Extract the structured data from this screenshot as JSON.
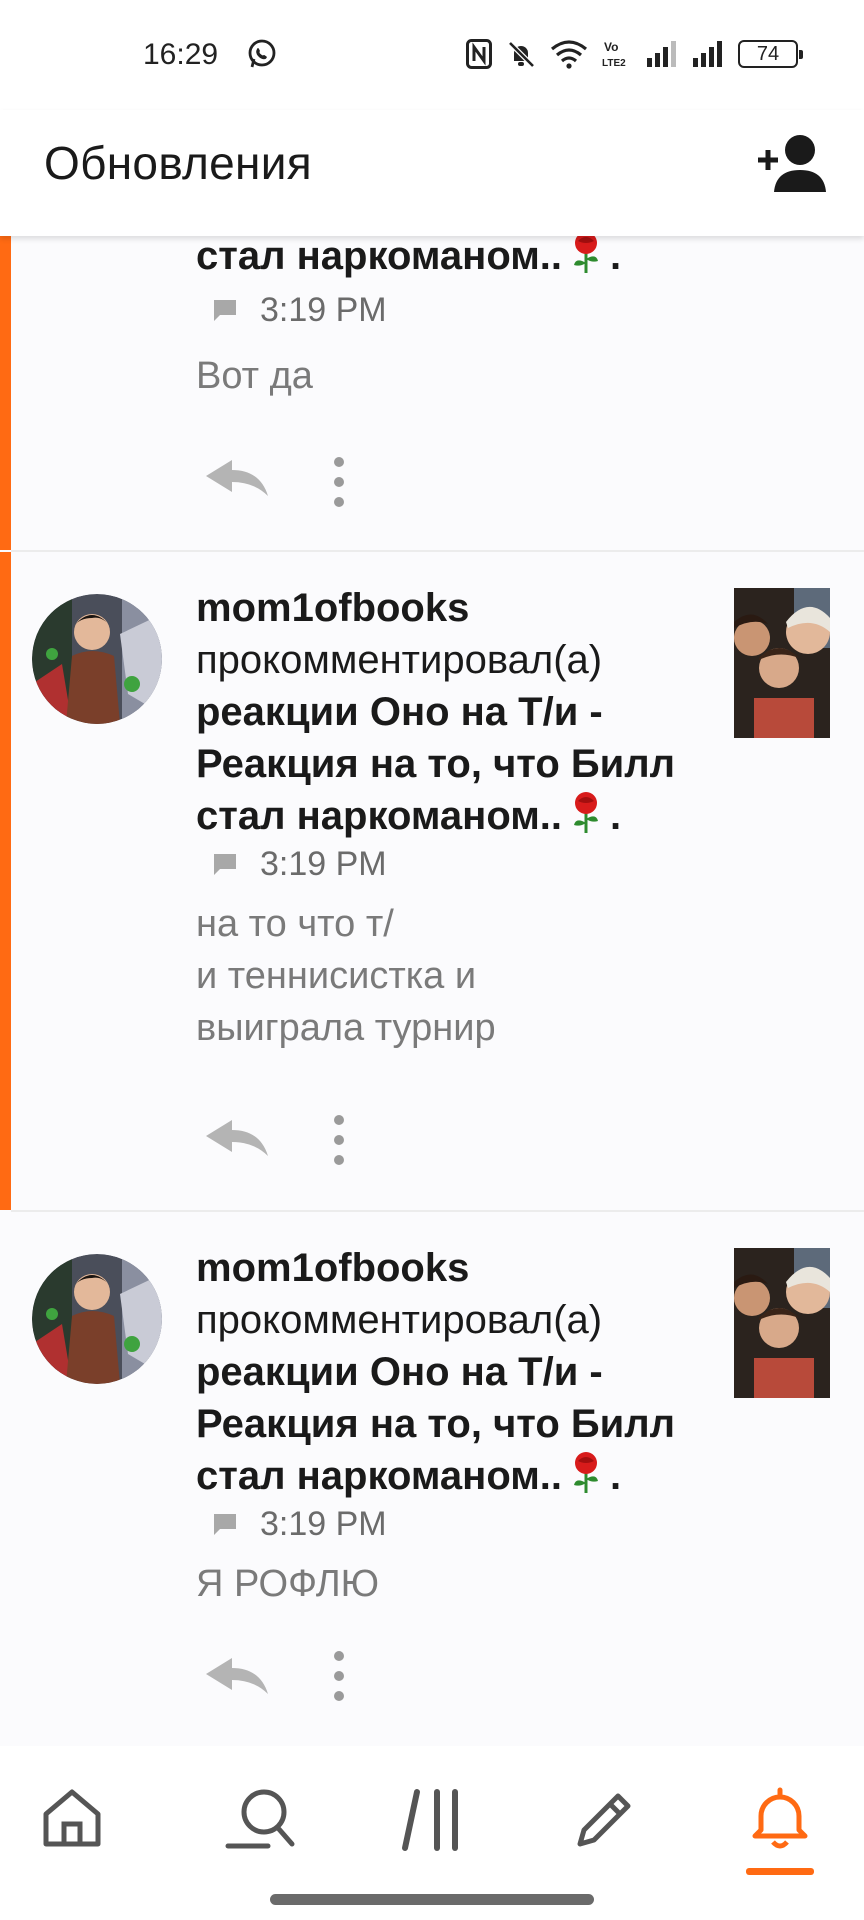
{
  "status_bar": {
    "time": "16:29",
    "battery": "74",
    "lte_top": "Vo",
    "lte_bottom": "LTE2"
  },
  "app_bar": {
    "title": "Обновления",
    "add_user_icon": "add-person-icon"
  },
  "feed": {
    "items": [
      {
        "title_tail": "стал наркоманом..",
        "dot": ".",
        "time": "3:19 PM",
        "comment": "Вот да",
        "unread": true
      },
      {
        "username": "mom1ofbooks",
        "action": "прокомментировал(а)",
        "title_lines": [
          "реакции Оно на Т/и -",
          "Реакция на то, что Билл",
          "стал наркоманом.."
        ],
        "dot": ".",
        "time": "3:19 PM",
        "comment_lines": [
          "на то что т/",
          "и теннисистка и",
          "выиграла турнир"
        ],
        "unread": true
      },
      {
        "username": "mom1ofbooks",
        "action": "прокомментировал(а)",
        "title_lines": [
          "реакции Оно на Т/и -",
          "Реакция на то, что Билл",
          "стал наркоманом.."
        ],
        "dot": ".",
        "time": "3:19 PM",
        "comment": "Я РОФЛЮ",
        "unread": false
      }
    ]
  },
  "bottom_nav": {
    "items": [
      "home-icon",
      "search-icon",
      "library-icon",
      "write-icon",
      "notifications-icon"
    ],
    "active": "notifications-icon",
    "accent": "#ff6a13"
  }
}
